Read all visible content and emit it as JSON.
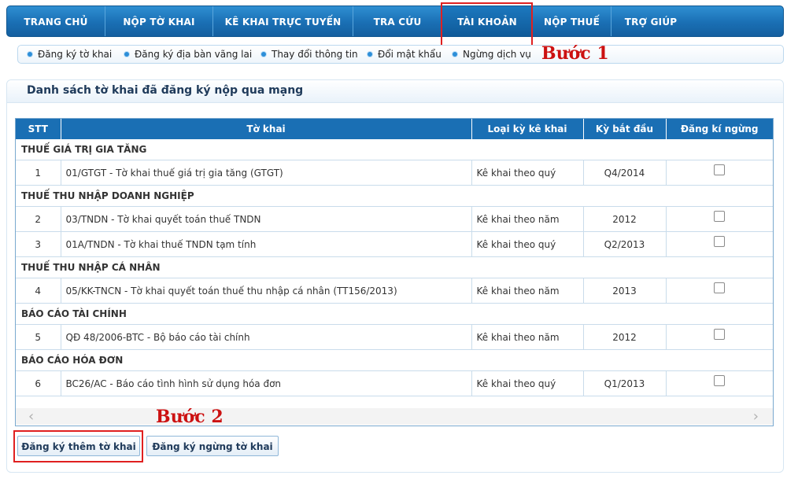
{
  "nav": {
    "items": [
      {
        "label": "TRANG CHỦ"
      },
      {
        "label": "NỘP TỜ KHAI"
      },
      {
        "label": "KÊ KHAI TRỰC TUYẾN"
      },
      {
        "label": "TRA CỨU"
      },
      {
        "label": "TÀI KHOẢN"
      },
      {
        "label": "NỘP THUẾ"
      },
      {
        "label": "TRỢ GIÚP"
      }
    ],
    "active": "TÀI KHOẢN"
  },
  "subnav": {
    "items": [
      {
        "label": "Đăng ký tờ khai"
      },
      {
        "label": "Đăng ký địa bàn vãng lai"
      },
      {
        "label": "Thay đổi thông tin"
      },
      {
        "label": "Đổi mật khẩu"
      },
      {
        "label": "Ngừng dịch vụ"
      }
    ]
  },
  "annotations": {
    "step1": "Bước 1",
    "step2": "Bước 2"
  },
  "panel": {
    "title": "Danh sách tờ khai đã đăng ký nộp qua mạng"
  },
  "table": {
    "headers": [
      "STT",
      "Tờ khai",
      "Loại kỳ kê khai",
      "Kỳ bắt đầu",
      "Đăng kí ngừng"
    ],
    "groups": [
      {
        "name": "THUẾ GIÁ TRỊ GIA TĂNG",
        "rows": [
          {
            "stt": "1",
            "form": "01/GTGT - Tờ khai thuế giá trị gia tăng (GTGT)",
            "period_type": "Kê khai theo quý",
            "start": "Q4/2014"
          }
        ]
      },
      {
        "name": "THUẾ THU NHẬP DOANH NGHIỆP",
        "rows": [
          {
            "stt": "2",
            "form": "03/TNDN - Tờ khai quyết toán thuế TNDN",
            "period_type": "Kê khai theo năm",
            "start": "2012"
          },
          {
            "stt": "3",
            "form": "01A/TNDN - Tờ khai thuế TNDN tạm tính",
            "period_type": "Kê khai theo quý",
            "start": "Q2/2013"
          }
        ]
      },
      {
        "name": "THUẾ THU NHẬP CÁ NHÂN",
        "rows": [
          {
            "stt": "4",
            "form": "05/KK-TNCN - Tờ khai quyết toán thuế thu nhập cá nhân (TT156/2013)",
            "period_type": "Kê khai theo năm",
            "start": "2013"
          }
        ]
      },
      {
        "name": "BÁO CÁO TÀI CHÍNH",
        "rows": [
          {
            "stt": "5",
            "form": "QĐ 48/2006-BTC - Bộ báo cáo tài chính",
            "period_type": "Kê khai theo năm",
            "start": "2012"
          }
        ]
      },
      {
        "name": "BÁO CÁO HÓA ĐƠN",
        "rows": [
          {
            "stt": "6",
            "form": "BC26/AC - Báo cáo tình hình sử dụng hóa đơn",
            "period_type": "Kê khai theo quý",
            "start": "Q1/2013"
          }
        ]
      }
    ]
  },
  "scroll": {
    "left_icon": "chevron-left-icon",
    "right_icon": "chevron-right-icon"
  },
  "buttons": {
    "register_more": "Đăng ký thêm tờ khai",
    "register_stop": "Đăng ký ngừng tờ khai"
  },
  "colors": {
    "nav_blue": "#1a6fb4",
    "annotation_red": "#cc1111"
  }
}
